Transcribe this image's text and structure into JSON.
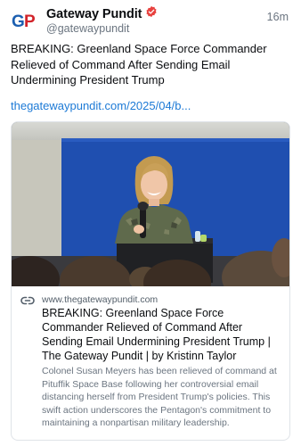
{
  "header": {
    "display_name": "Gateway Pundit",
    "handle": "@gatewaypundit",
    "timestamp": "16m",
    "avatar_text": "GP",
    "verified_icon": "verified-badge-icon"
  },
  "post": {
    "text": "BREAKING: Greenland Space Force Commander Relieved of Command After Sending Email Undermining President Trump",
    "link_text": "thegatewaypundit.com/2025/04/b..."
  },
  "card": {
    "domain": "www.thegatewaypundit.com",
    "title": "BREAKING: Greenland Space Force Commander Relieved of Command After Sending Email Undermining President Trump | The Gateway Pundit | by Kristinn Taylor",
    "description": "Colonel Susan Meyers has been relieved of command at Pituffik Space Base following her controversial email distancing herself from President Trump's policies. This swift action underscores the Pentagon's commitment to maintaining a nonpartisan military leadership.",
    "link_icon": "link-icon"
  },
  "colors": {
    "verified": "#e8423f",
    "link": "#1d7ad6",
    "avatar_blue": "#1c5fb0",
    "avatar_red": "#d2232a"
  }
}
